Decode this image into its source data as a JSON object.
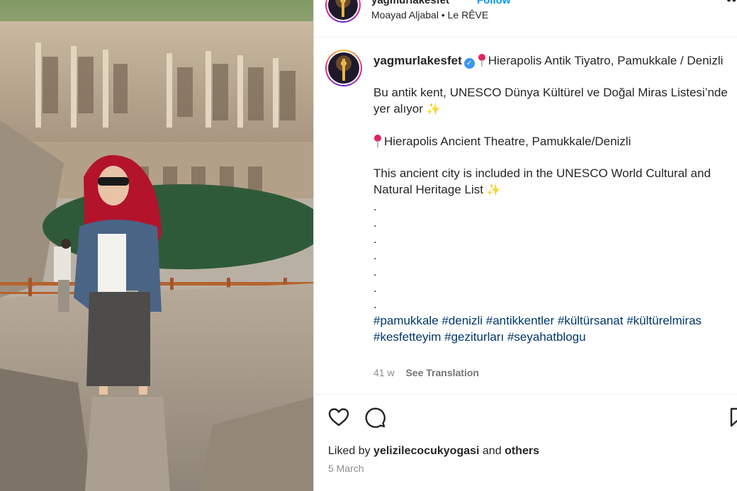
{
  "header": {
    "username": "yagmurlakesfet",
    "follow_label": "Follow",
    "audio_artist": "Moayad Aljabal",
    "separator": "•",
    "audio_track": "Le RÊVE",
    "more_icon": "more-horizontal-icon"
  },
  "caption": {
    "username": "yagmurlakesfet",
    "verified_icon": "verified-badge-icon",
    "location_tr": "Hierapolis Antik Tiyatro, Pamukkale / Denizli",
    "desc_tr": "Bu antik kent, UNESCO Dünya Kültürel ve Doğal Miras Listesi’nde yer alıyor",
    "location_en": "Hierapolis Ancient Theatre, Pamukkale/Denizli",
    "desc_en": "This ancient city is included in the UNESCO World Cultural and Natural Heritage List",
    "sparkle": "✨",
    "dots": [
      ".",
      ".",
      ".",
      ".",
      ".",
      ".",
      "."
    ],
    "hashtags_line1": "#pamukkale #denizli #antikkentler #kültürsanat #kültürelmiras",
    "hashtags_line2": "#kesfetteyim #geziturları #seyahatblogu",
    "age": "41 w",
    "see_translation": "See Translation"
  },
  "actions": {
    "like_icon": "heart-icon",
    "comment_icon": "comment-icon",
    "save_icon": "bookmark-icon",
    "liked_prefix": "Liked by",
    "liked_user": "yelizilecocukyogasi",
    "liked_and": "and",
    "liked_others": "others",
    "date": "5 March"
  },
  "colors": {
    "link": "#00376b",
    "follow": "#0095f6",
    "verified": "#3897f0",
    "muted": "#8e8e8e"
  }
}
